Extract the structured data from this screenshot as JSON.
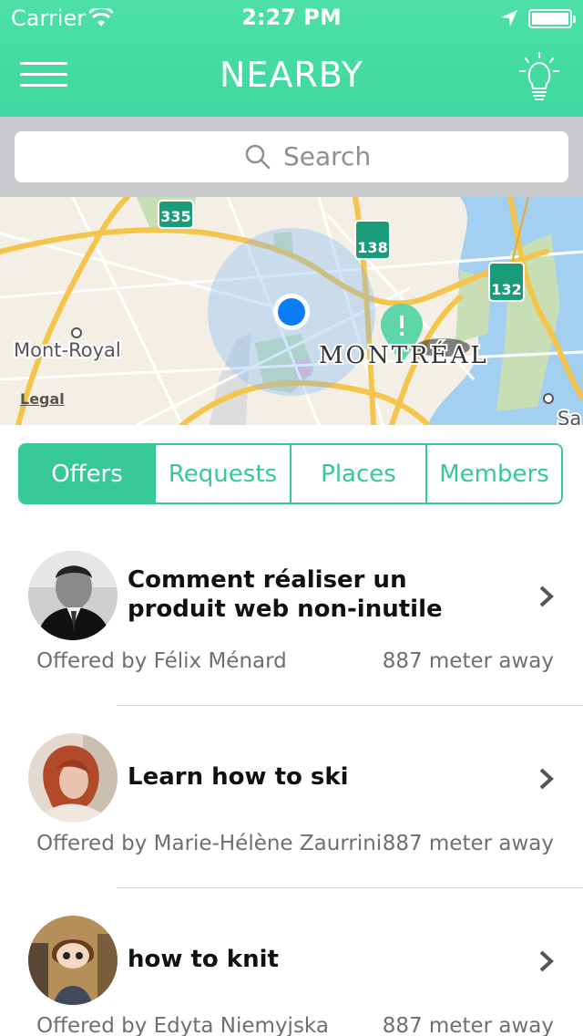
{
  "status_bar": {
    "carrier": "Carrier",
    "time": "2:27 PM"
  },
  "nav": {
    "title": "NEARBY",
    "left_icon": "menu-icon",
    "right_icon": "lightbulb-icon"
  },
  "search": {
    "placeholder": "Search"
  },
  "map": {
    "labels": {
      "mont_royal": "Mont-Royal",
      "montreal": "MONTRÉAL",
      "sa": "Sa",
      "legal": "Legal"
    },
    "route_shields": [
      "335",
      "138",
      "132"
    ]
  },
  "tabs": [
    {
      "label": "Offers",
      "active": true
    },
    {
      "label": "Requests",
      "active": false
    },
    {
      "label": "Places",
      "active": false
    },
    {
      "label": "Members",
      "active": false
    }
  ],
  "offers": [
    {
      "title": "Comment réaliser un produit web non-inutile",
      "offered_by": "Offered by Félix Ménard",
      "distance": "887 meter away"
    },
    {
      "title": "Learn how to ski",
      "offered_by": "Offered by Marie-Hélène Zaurrini",
      "distance": "887 meter away"
    },
    {
      "title": "how to knit",
      "offered_by": "Offered by Edyta Niemyjska",
      "distance": "887 meter away"
    }
  ],
  "colors": {
    "accent": "#3fd6a1",
    "segment": "#36c997",
    "search_bg": "#c9cacd"
  }
}
